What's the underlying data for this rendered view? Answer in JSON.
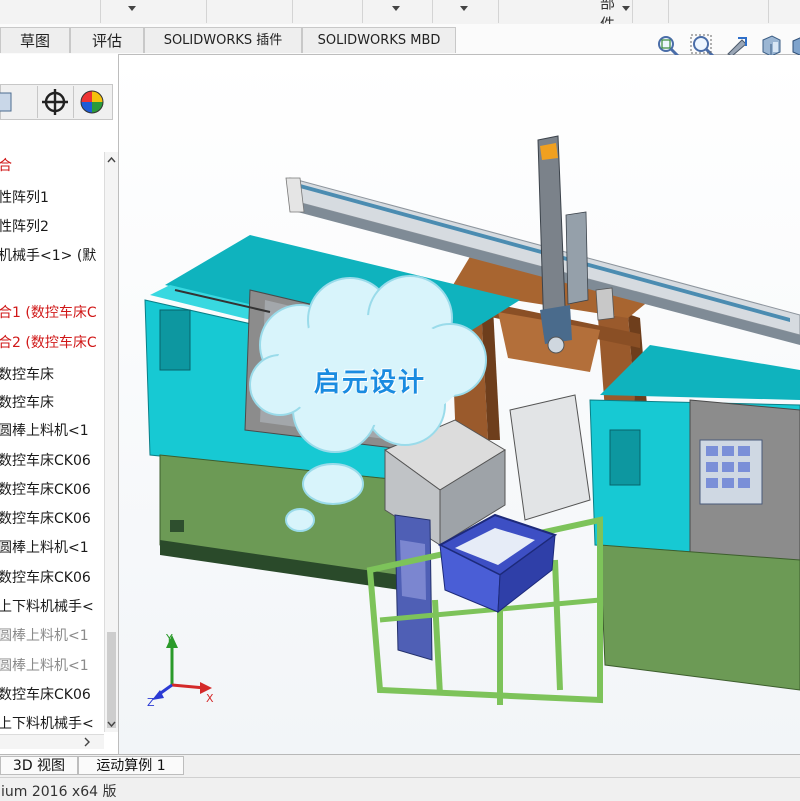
{
  "top_toolbar": {
    "partial_label": "部件"
  },
  "command_tabs": [
    {
      "label": "草图"
    },
    {
      "label": "评估"
    },
    {
      "label": "SOLIDWORKS 插件"
    },
    {
      "label": "SOLIDWORKS MBD"
    }
  ],
  "heads_up_icons": [
    "zoom-to-fit-icon",
    "zoom-area-icon",
    "previous-view-icon",
    "section-view-icon",
    "view-orientation-icon"
  ],
  "panel_tabs": [
    "feature-manager-icon",
    "dimxpert-icon",
    "appearance-icon"
  ],
  "feature_tree": {
    "items": [
      {
        "label": "合",
        "color": "red"
      },
      {
        "label": "性阵列1",
        "color": "black"
      },
      {
        "label": "性阵列2",
        "color": "black"
      },
      {
        "label": "机械手<1> (默",
        "color": "black"
      },
      {
        "label": "合1 (数控车床C",
        "color": "red"
      },
      {
        "label": "合2 (数控车床C",
        "color": "red"
      },
      {
        "label": "数控车床",
        "color": "black"
      },
      {
        "label": "数控车床",
        "color": "black"
      },
      {
        "label": "圆棒上料机<1",
        "color": "black"
      },
      {
        "label": "数控车床CK06",
        "color": "black"
      },
      {
        "label": "数控车床CK06",
        "color": "black"
      },
      {
        "label": "数控车床CK06",
        "color": "black"
      },
      {
        "label": "圆棒上料机<1",
        "color": "black"
      },
      {
        "label": "数控车床CK06",
        "color": "black"
      },
      {
        "label": "上下料机械手<",
        "color": "black"
      },
      {
        "label": "圆棒上料机<1",
        "color": "gray"
      },
      {
        "label": "圆棒上料机<1",
        "color": "gray"
      },
      {
        "label": "数控车床CK06",
        "color": "black"
      },
      {
        "label": "上下料机械手<",
        "color": "black"
      }
    ]
  },
  "bottom_tabs": [
    {
      "label": "3D 视图"
    },
    {
      "label": "运动算例 1"
    }
  ],
  "status_bar": {
    "text": "ium 2016 x64 版"
  },
  "watermark": {
    "text": "启元设计"
  },
  "triad": {
    "x": "X",
    "y": "Y",
    "z": "Z"
  },
  "colors": {
    "machine_cyan": "#17c9d3",
    "machine_base_green": "#6c9a55",
    "gantry_brown": "#9a5a2c",
    "frame_green": "#a9d88f",
    "bin_blue": "#3d4fc4",
    "cloud_fill": "#d8f4fb",
    "cloud_text": "#1a8be0"
  }
}
